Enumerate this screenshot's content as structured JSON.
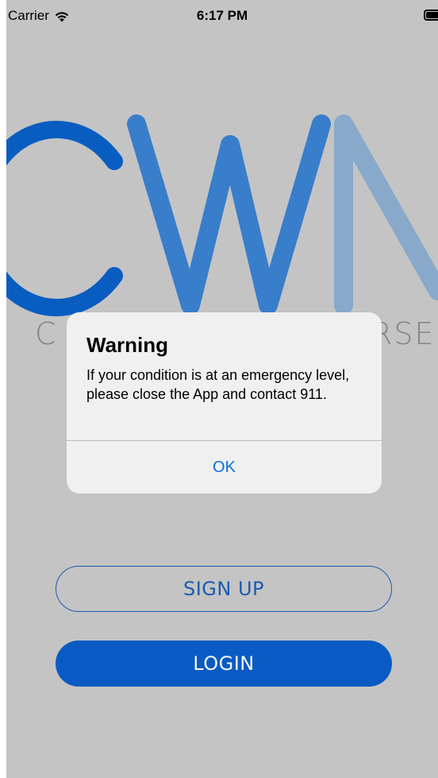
{
  "status_bar": {
    "carrier": "Carrier",
    "time": "6:17 PM"
  },
  "logo": {
    "letters": [
      "C",
      "W",
      "N"
    ],
    "subtitle_left": "C",
    "subtitle_right": "RSE",
    "colors": {
      "c": "#0a61c9",
      "w": "#3b84d4",
      "n": "#8fb0d4"
    }
  },
  "buttons": {
    "signup_label": "SIGN UP",
    "login_label": "LOGIN"
  },
  "alert": {
    "title": "Warning",
    "message": "If your condition is at an emergency level, please close the App and contact 911.",
    "ok_label": "OK"
  },
  "colors": {
    "background": "#cccccc",
    "primary": "#0a5fcb",
    "link": "#0a6fd6"
  }
}
